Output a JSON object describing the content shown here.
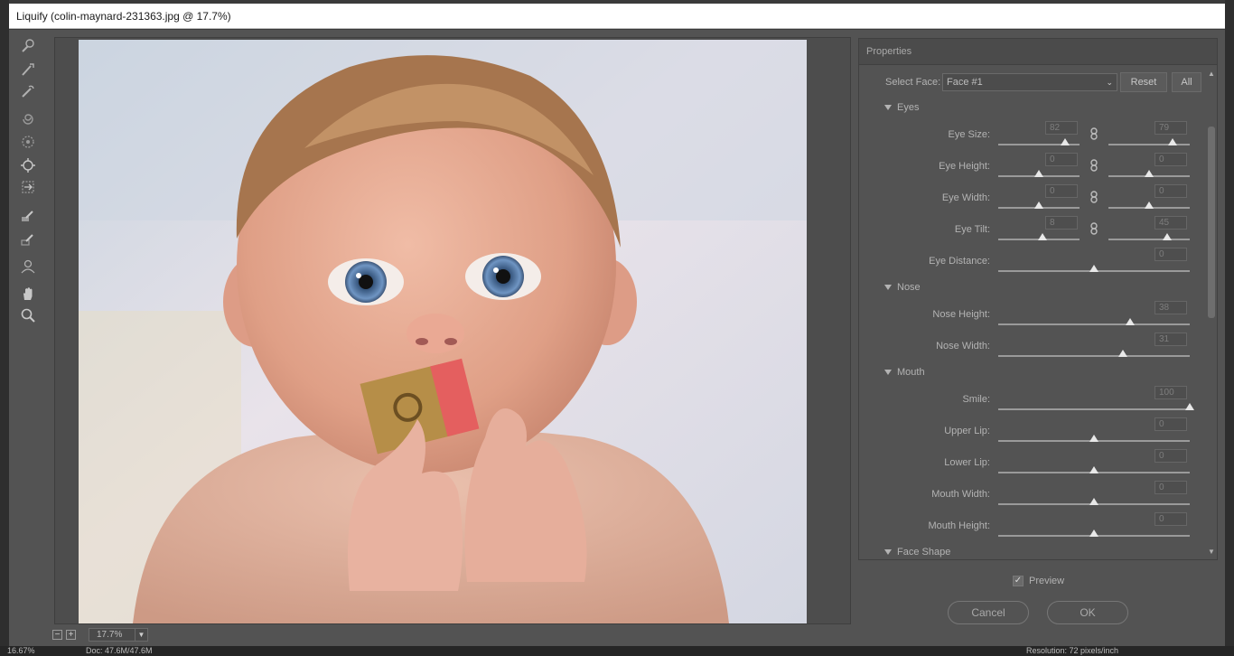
{
  "window": {
    "title": "Liquify (colin-maynard-231363.jpg @ 17.7%)"
  },
  "zoom": {
    "minus": "−",
    "plus": "+",
    "value": "17.7%"
  },
  "panel": {
    "title": "Properties"
  },
  "face": {
    "label": "Select Face:",
    "value": "Face #1",
    "reset": "Reset",
    "all": "All"
  },
  "sections": {
    "eyes": "Eyes",
    "nose": "Nose",
    "mouth": "Mouth",
    "face_shape": "Face Shape"
  },
  "eyes": {
    "size": {
      "label": "Eye Size:",
      "left": "82",
      "right": "79",
      "left_level": 0.82,
      "right_level": 0.79
    },
    "height": {
      "label": "Eye Height:",
      "left": "0",
      "right": "0",
      "left_level": 0.5,
      "right_level": 0.5
    },
    "width": {
      "label": "Eye Width:",
      "left": "0",
      "right": "0",
      "left_level": 0.5,
      "right_level": 0.5
    },
    "tilt": {
      "label": "Eye Tilt:",
      "left": "8",
      "right": "45",
      "left_level": 0.54,
      "right_level": 0.72
    },
    "distance": {
      "label": "Eye Distance:",
      "value": "0",
      "level": 0.5
    }
  },
  "nose": {
    "height": {
      "label": "Nose Height:",
      "value": "38",
      "level": 0.69
    },
    "width": {
      "label": "Nose Width:",
      "value": "31",
      "level": 0.65
    }
  },
  "mouth": {
    "smile": {
      "label": "Smile:",
      "value": "100",
      "level": 1.0
    },
    "upper_lip": {
      "label": "Upper Lip:",
      "value": "0",
      "level": 0.5
    },
    "lower_lip": {
      "label": "Lower Lip:",
      "value": "0",
      "level": 0.5
    },
    "mouth_width": {
      "label": "Mouth Width:",
      "value": "0",
      "level": 0.5
    },
    "mouth_height": {
      "label": "Mouth Height:",
      "value": "0",
      "level": 0.5
    }
  },
  "preview": {
    "label": "Preview",
    "checked": true
  },
  "buttons": {
    "cancel": "Cancel",
    "ok": "OK"
  },
  "status": {
    "zoom": "16.67%",
    "doc": "Doc: 47.6M/47.6M",
    "resolution": "Resolution: 72 pixels/inch"
  },
  "icons": [
    "forward-warp-icon",
    "reconstruct-icon",
    "smooth-icon",
    "twirl-icon",
    "pucker-icon",
    "face-tool-icon",
    "push-left-icon",
    "freeze-mask-icon",
    "thaw-mask-icon",
    "face-icon",
    "hand-icon",
    "zoom-icon"
  ]
}
